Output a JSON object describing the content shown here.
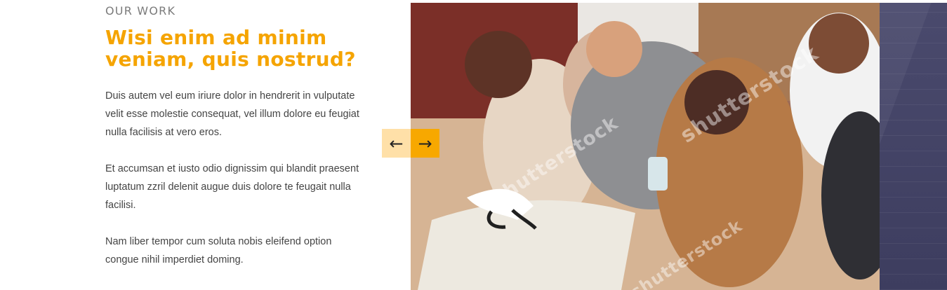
{
  "section": {
    "eyebrow": "OUR WORK",
    "headline": "Wisi enim ad minim veniam, quis nostrud?",
    "paragraphs": [
      "Duis autem vel eum iriure dolor in hendrerit in vulputate velit esse molestie consequat, vel illum dolore eu feugiat nulla facilisis at vero eros.",
      "Et accumsan et iusto odio dignissim qui blandit praesent luptatum zzril delenit augue duis dolore te feugait nulla facilisi.",
      "Nam liber tempor cum soluta nobis eleifend option congue nihil imperdiet doming."
    ]
  },
  "carousel": {
    "prev_symbol": "←",
    "next_symbol": "→",
    "watermark_text": "shutterstock"
  },
  "colors": {
    "accent": "#f5a400",
    "prev_button_bg": "#ffe0a8",
    "next_button_bg": "#f7a800",
    "side_panel": "#45456a"
  }
}
